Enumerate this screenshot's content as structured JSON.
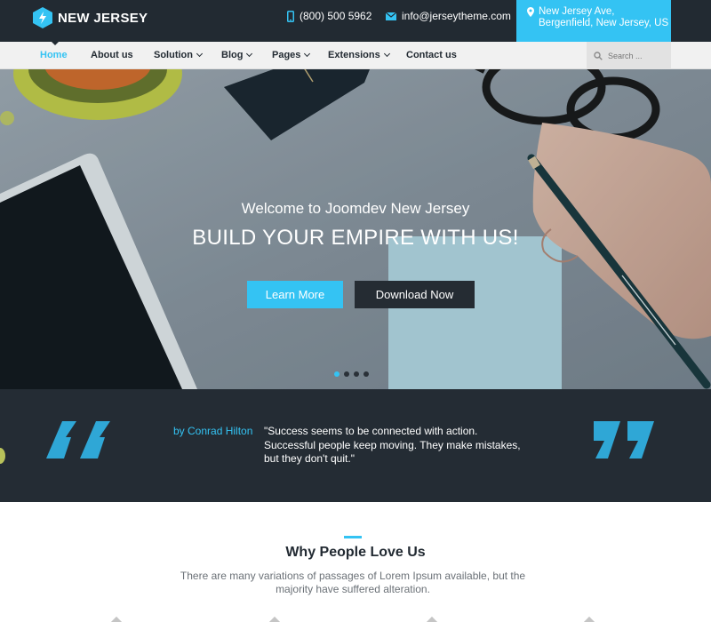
{
  "brand": {
    "name": "NEW JERSEY",
    "accent": "#34c3f3",
    "dark": "#222a32"
  },
  "contact": {
    "phone": "(800) 500 5962",
    "email": "info@jerseytheme.com",
    "address_line1": "New Jersey Ave,",
    "address_line2": "Bergenfield, New Jersey, US"
  },
  "nav": {
    "items": [
      {
        "label": "Home",
        "active": true,
        "dropdown": false
      },
      {
        "label": "About us",
        "active": false,
        "dropdown": false
      },
      {
        "label": "Solution",
        "active": false,
        "dropdown": true
      },
      {
        "label": "Blog",
        "active": false,
        "dropdown": true
      },
      {
        "label": "Pages",
        "active": false,
        "dropdown": true
      },
      {
        "label": "Extensions",
        "active": false,
        "dropdown": true
      },
      {
        "label": "Contact us",
        "active": false,
        "dropdown": false
      }
    ],
    "search_placeholder": "Search ..."
  },
  "hero": {
    "subtitle": "Welcome to Joomdev New Jersey",
    "title": "BUILD YOUR EMPIRE WITH US!",
    "primary_button": "Learn More",
    "secondary_button": "Download Now",
    "slide_count": 4,
    "active_slide": 1
  },
  "quote": {
    "author": "by Conrad Hilton",
    "text": "\"Success seems to be connected with action. Successful people keep moving. They make mistakes, but they don't quit.\""
  },
  "why": {
    "title": "Why People Love Us",
    "description": "There are many variations of passages of Lorem Ipsum available, but the majority have suffered alteration."
  }
}
